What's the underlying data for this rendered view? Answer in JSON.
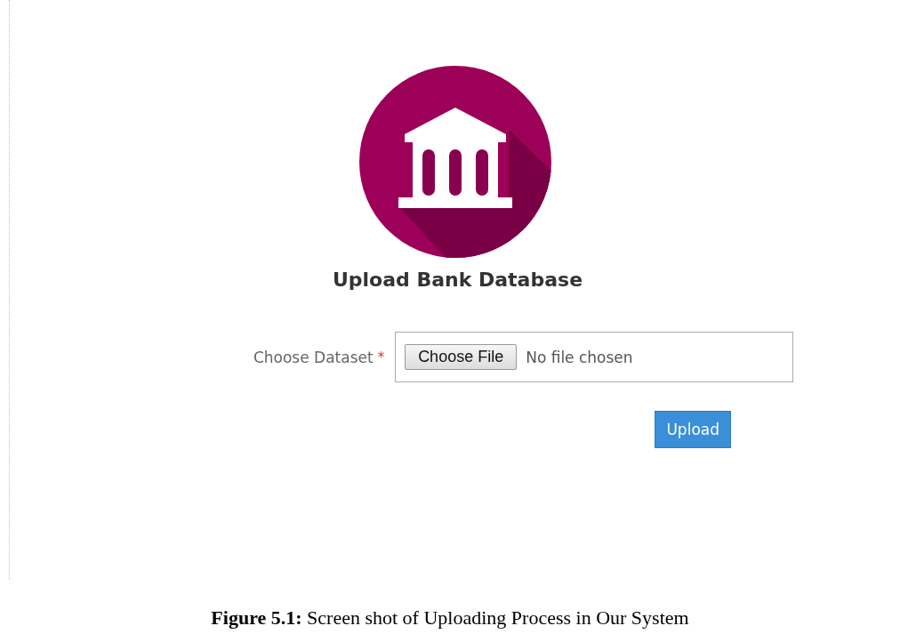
{
  "page": {
    "heading": "Upload Bank Database",
    "form": {
      "label": "Choose Dataset",
      "required_mark": "*",
      "file_button": "Choose File",
      "file_status": "No file chosen"
    },
    "buttons": [
      "Upload"
    ]
  },
  "caption": "**Figure 5.1:** Screen shot of Uploading Process in Our System"
}
